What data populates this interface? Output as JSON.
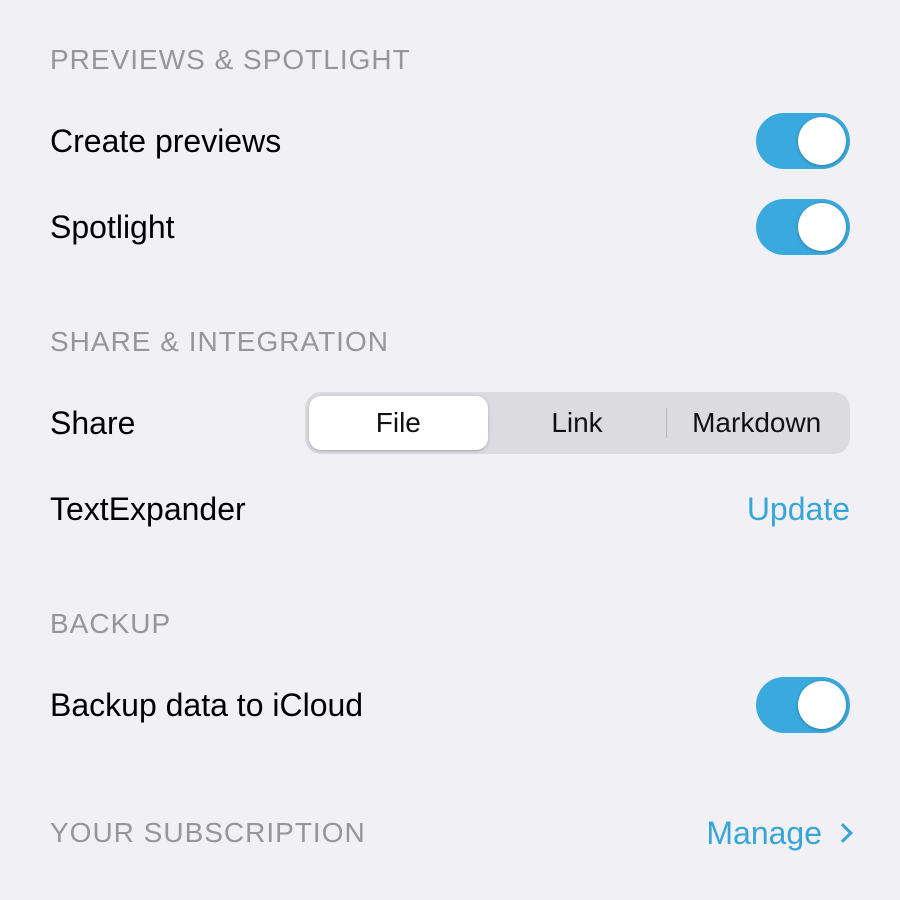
{
  "colors": {
    "accent": "#36a6d8",
    "headerText": "#96959b",
    "background": "#f1f0f4"
  },
  "sections": {
    "previews": {
      "header": "Previews & Spotlight",
      "items": {
        "createPreviews": {
          "label": "Create previews",
          "on": true
        },
        "spotlight": {
          "label": "Spotlight",
          "on": true
        }
      }
    },
    "share": {
      "header": "Share & Integration",
      "shareRow": {
        "label": "Share",
        "options": [
          "File",
          "Link",
          "Markdown"
        ],
        "selectedIndex": 0
      },
      "textExpander": {
        "label": "TextExpander",
        "action": "Update"
      }
    },
    "backup": {
      "header": "Backup",
      "items": {
        "icloud": {
          "label": "Backup data to iCloud",
          "on": true
        }
      }
    },
    "subscription": {
      "header": "Your Subscription",
      "action": "Manage"
    }
  }
}
